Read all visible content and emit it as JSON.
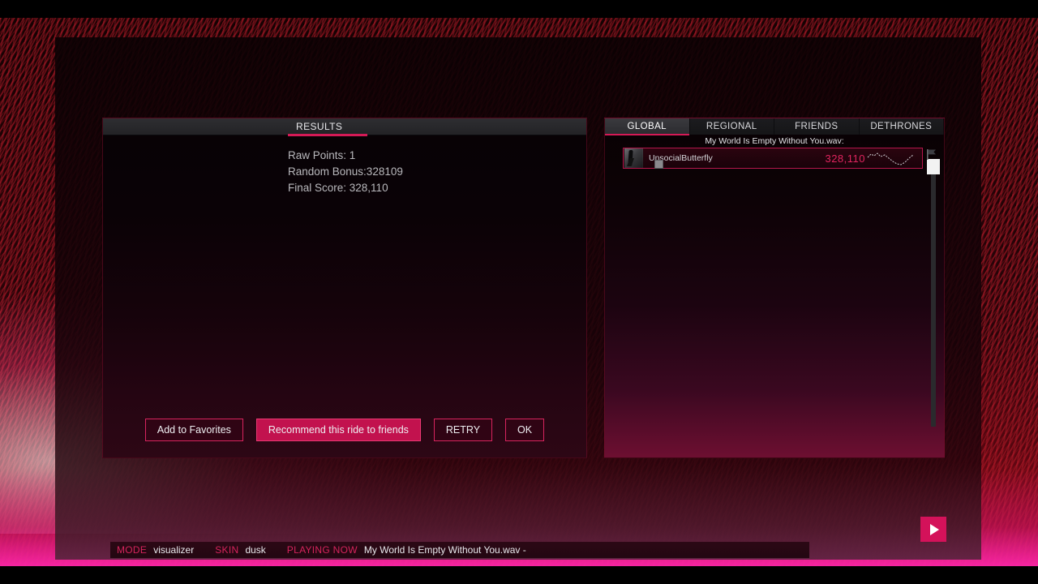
{
  "background": {
    "mode_visual": "radial-burst-visualizer"
  },
  "results_panel": {
    "tab_label": "RESULTS",
    "lines": [
      "Raw Points: 1",
      "Random Bonus:328109",
      "Final Score: 328,110"
    ],
    "raw_points": "1",
    "random_bonus": "328109",
    "final_score": "328,110",
    "buttons": [
      {
        "label": "Add to Favorites",
        "style": "outline"
      },
      {
        "label": "Recommend this ride to friends",
        "style": "primary"
      },
      {
        "label": "RETRY",
        "style": "outline"
      },
      {
        "label": "OK",
        "style": "outline"
      }
    ]
  },
  "leaderboard": {
    "tabs": [
      {
        "label": "GLOBAL",
        "active": true
      },
      {
        "label": "REGIONAL",
        "active": false
      },
      {
        "label": "FRIENDS",
        "active": false
      },
      {
        "label": "DETHRONES",
        "active": false
      }
    ],
    "song_header": "My World Is Empty Without You.wav:",
    "entries": [
      {
        "name": "UnsocialButterfly",
        "score": "328,110"
      }
    ]
  },
  "statusbar": {
    "mode_key": "MODE",
    "mode_value": "visualizer",
    "skin_key": "SKIN",
    "skin_value": "dusk",
    "playing_key": "PLAYING NOW",
    "playing_value": "My World Is Empty Without You.wav -"
  },
  "colors": {
    "accent": "#d41a56",
    "score": "#e0245e",
    "primary_button": "#c2124e"
  }
}
